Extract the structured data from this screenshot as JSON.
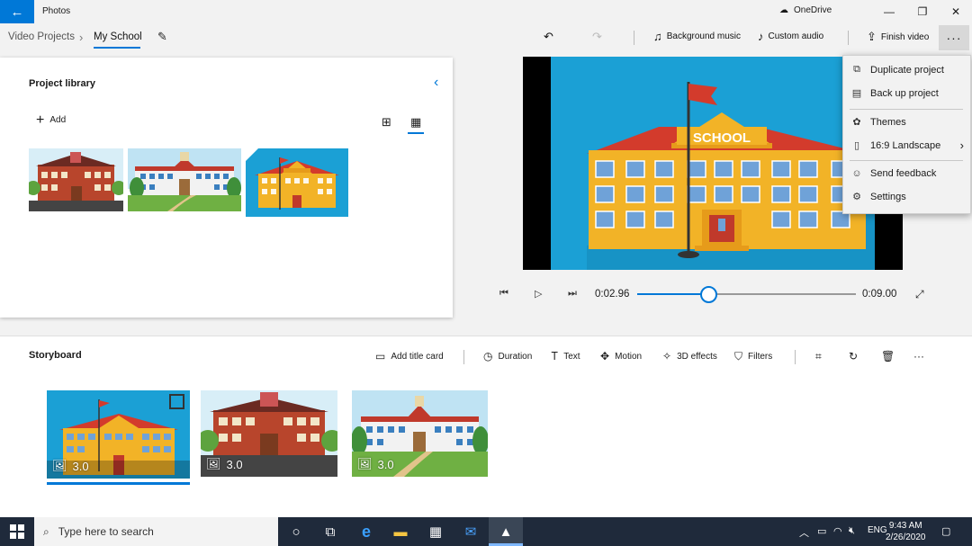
{
  "window": {
    "app_title": "Photos",
    "onedrive_label": "OneDrive",
    "controls": {
      "minimize": "—",
      "maximize": "❐",
      "close": "✕"
    }
  },
  "nav": {
    "breadcrumb_root": "Video Projects",
    "breadcrumb_sep": "›",
    "project_name": "My School"
  },
  "toolbar": {
    "background_music": "Background music",
    "custom_audio": "Custom audio",
    "finish_video": "Finish video",
    "more": "···"
  },
  "library": {
    "title": "Project library",
    "add_label": "Add"
  },
  "playback": {
    "current_time": "0:02.96",
    "total_time": "0:09.00",
    "progress": 0.33
  },
  "menu": {
    "items": [
      {
        "label": "Duplicate project",
        "icon": "duplicate-icon"
      },
      {
        "label": "Back up project",
        "icon": "backup-icon"
      },
      {
        "label": "Themes",
        "icon": "palette-icon"
      },
      {
        "label": "16:9 Landscape",
        "icon": "aspect-ratio-icon",
        "has_submenu": true
      },
      {
        "label": "Send feedback",
        "icon": "feedback-icon"
      },
      {
        "label": "Settings",
        "icon": "gear-icon"
      }
    ]
  },
  "storyboard": {
    "title": "Storyboard",
    "tools": {
      "add_title_card": "Add title card",
      "duration": "Duration",
      "text": "Text",
      "motion": "Motion",
      "effects_3d": "3D effects",
      "filters": "Filters"
    },
    "clips": [
      {
        "duration": "3.0"
      },
      {
        "duration": "3.0"
      },
      {
        "duration": "3.0"
      }
    ]
  },
  "preview": {
    "sign_text": "SCHOOL"
  },
  "taskbar": {
    "search_placeholder": "Type here to search",
    "time": "9:43 AM",
    "date": "2/26/2020",
    "lang": "ENG"
  },
  "colors": {
    "accent": "#0078d7",
    "taskbar": "#1f2a3b",
    "sky": "#1ba0d5"
  }
}
